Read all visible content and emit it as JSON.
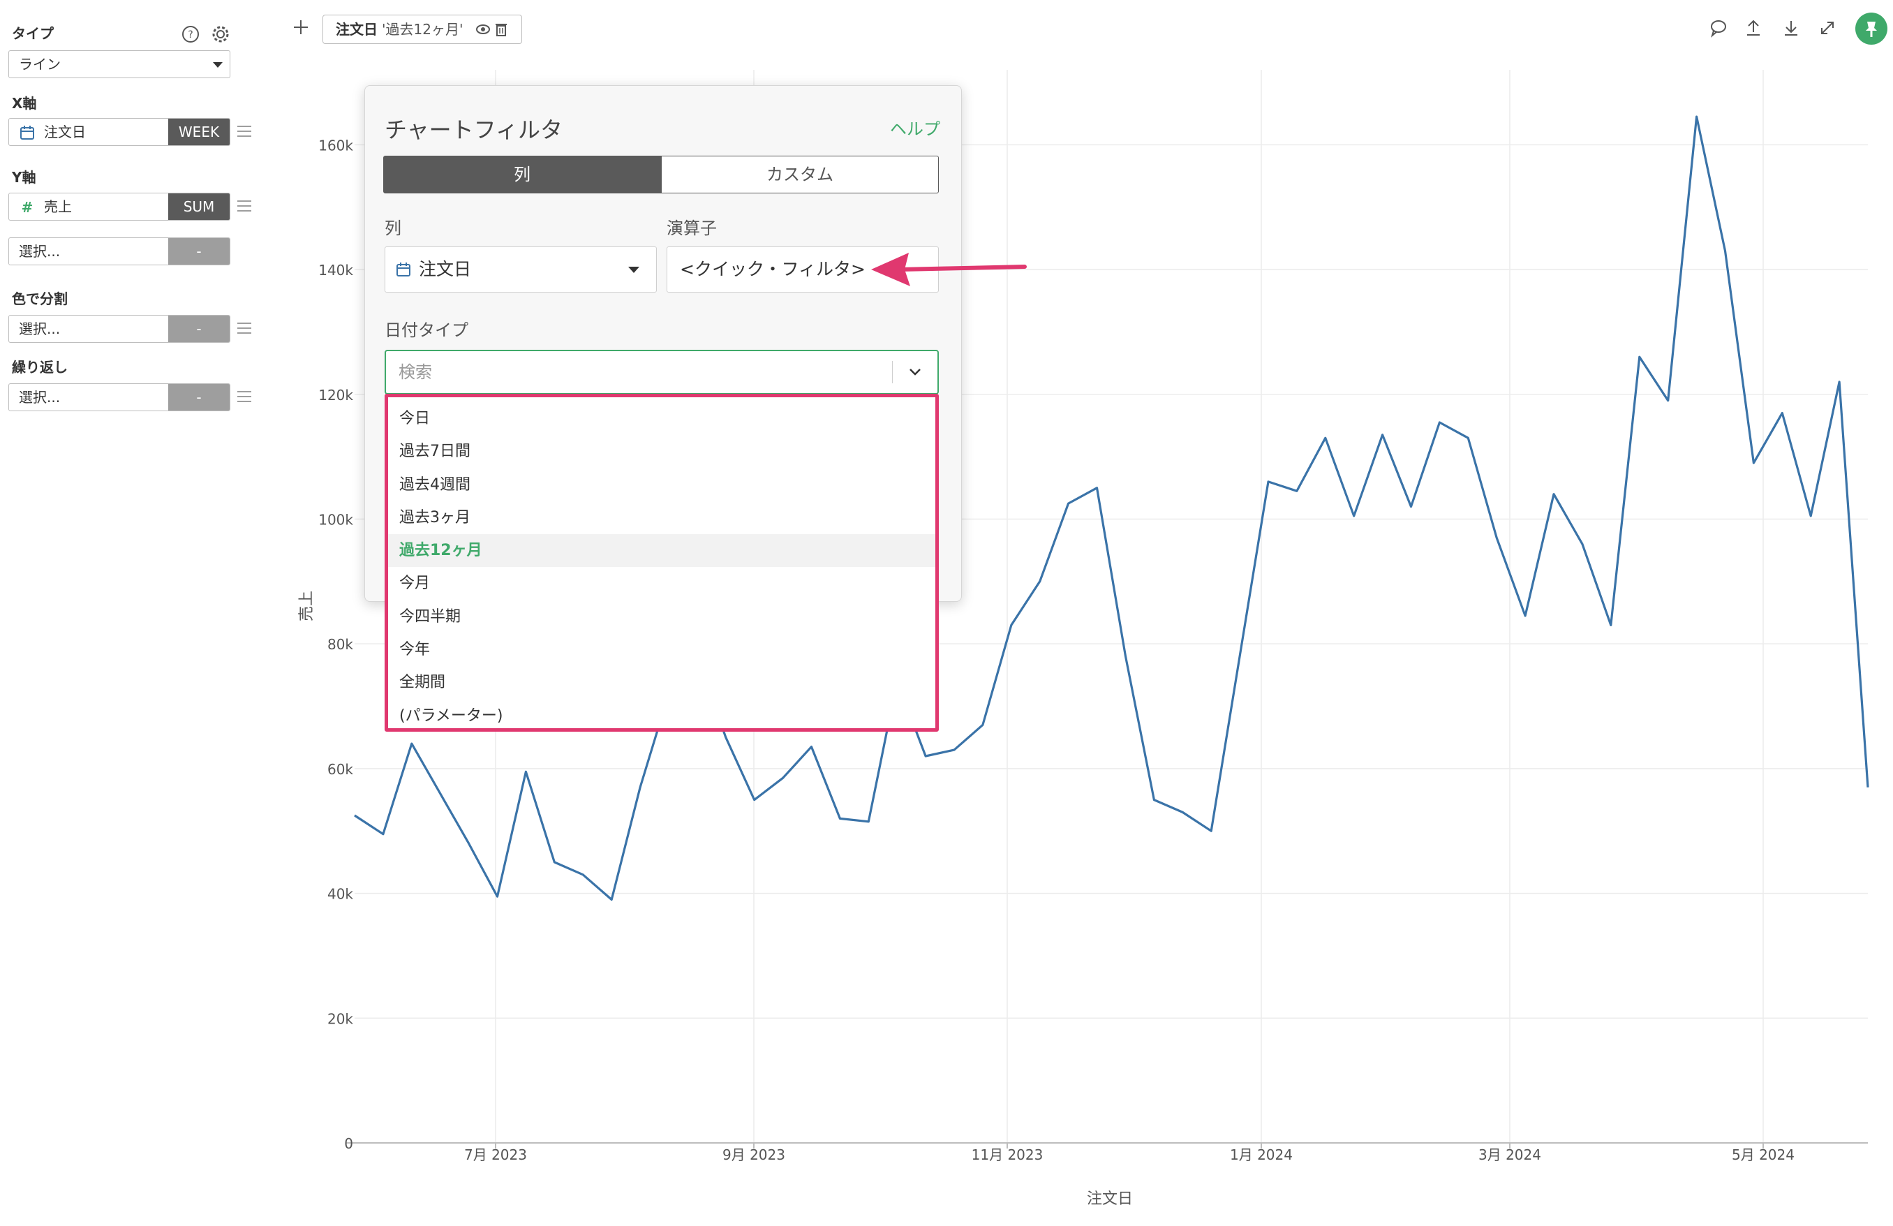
{
  "sidebar": {
    "type_label": "タイプ",
    "type_value": "ライン",
    "x_axis_label": "X軸",
    "x_field": "注文日",
    "x_agg": "WEEK",
    "y_axis_label": "Y軸",
    "y_field": "売上",
    "y_agg": "SUM",
    "y_add_placeholder": "選択...",
    "y_add_agg": "-",
    "color_label": "色で分割",
    "color_placeholder": "選択...",
    "color_agg": "-",
    "repeat_label": "繰り返し",
    "repeat_placeholder": "選択...",
    "repeat_agg": "-"
  },
  "topbar": {
    "chip_column": "注文日",
    "chip_value": "'過去12ヶ月'"
  },
  "dialog": {
    "title": "チャートフィルタ",
    "help": "ヘルプ",
    "tab_column": "列",
    "tab_custom": "カスタム",
    "column_label": "列",
    "column_value": "注文日",
    "operator_label": "演算子",
    "operator_value": "<クイック・フィルタ>",
    "date_type_label": "日付タイプ",
    "search_placeholder": "検索",
    "options": [
      "今日",
      "過去7日間",
      "過去4週間",
      "過去3ヶ月",
      "過去12ヶ月",
      "今月",
      "今四半期",
      "今年",
      "全期間",
      "(パラメーター)"
    ],
    "selected_option": "過去12ヶ月"
  },
  "colors": {
    "accent_green": "#3fa96a",
    "line_blue": "#3a73a8",
    "highlight_pink": "#e0386f",
    "dark_button": "#5a5a5a"
  },
  "chart_data": {
    "type": "line",
    "xlabel": "注文日",
    "ylabel": "売上",
    "x_ticks": [
      "7月 2023",
      "9月 2023",
      "11月 2023",
      "1月 2024",
      "3月 2024",
      "5月 2024"
    ],
    "y_ticks": [
      "0",
      "20k",
      "40k",
      "60k",
      "80k",
      "100k",
      "120k",
      "140k",
      "160k"
    ],
    "ylim": [
      0,
      170000
    ],
    "grid": true,
    "series": [
      {
        "values": [
          52500,
          49500,
          64000,
          56000,
          48000,
          39500,
          59500,
          45000,
          43000,
          39000,
          57000,
          72000,
          78000,
          65000,
          55000,
          58500,
          63500,
          52000,
          51500,
          74000,
          62000,
          63000,
          67000,
          83000,
          90000,
          102500,
          105000,
          78000,
          55000,
          53000,
          50000,
          78000,
          106000,
          104500,
          113000,
          100500,
          113500,
          102000,
          115500,
          113000,
          97000,
          84500,
          104000,
          96000,
          83000,
          126000,
          119000,
          164500,
          143000,
          109000,
          117000,
          100500,
          122000,
          57000
        ]
      }
    ]
  }
}
